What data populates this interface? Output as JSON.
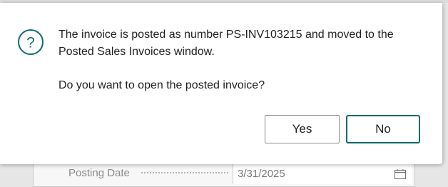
{
  "dialog": {
    "message_line1": "The invoice is posted as number PS-INV103215 and moved to the",
    "message_line2": "Posted Sales Invoices window.",
    "question": "Do you want to open the posted invoice?",
    "icon": "question-circle-icon",
    "yes_label": "Yes",
    "no_label": "No"
  },
  "background": {
    "field_label": "Posting Date",
    "field_value": "3/31/2025",
    "field_icon": "calendar-icon"
  },
  "colors": {
    "accent": "#0f6b6f",
    "text": "#212121"
  }
}
